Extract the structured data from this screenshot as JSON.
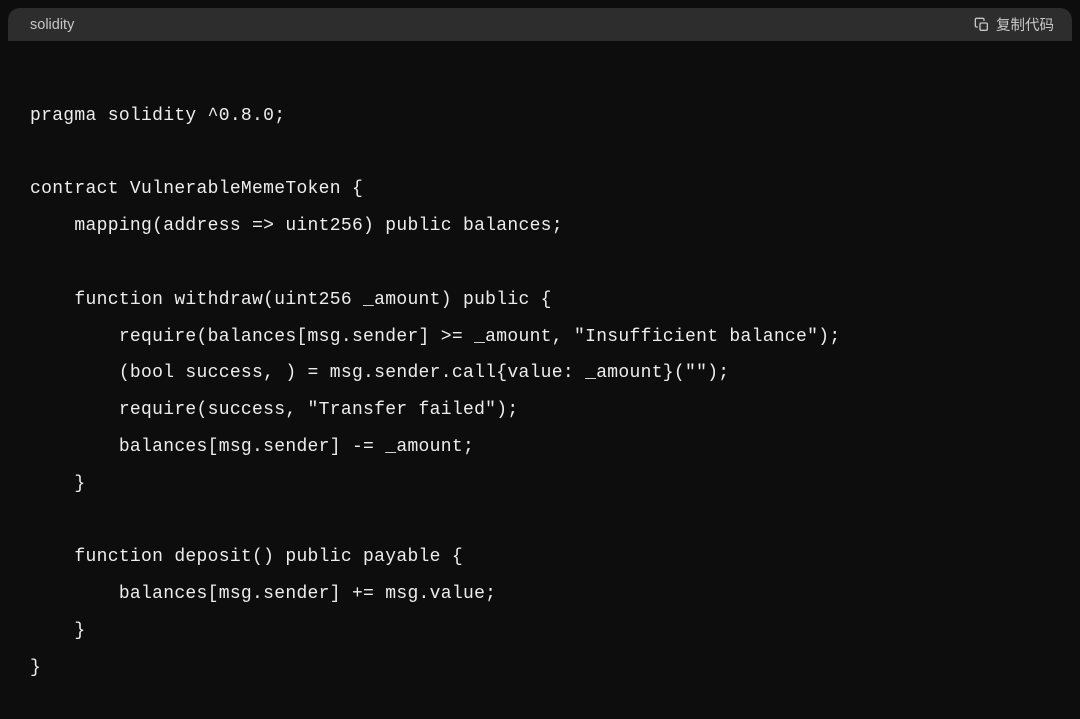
{
  "header": {
    "language": "solidity",
    "copy_label": "复制代码"
  },
  "code": {
    "lines": [
      "",
      "pragma solidity ^0.8.0;",
      "",
      "contract VulnerableMemeToken {",
      "    mapping(address => uint256) public balances;",
      "",
      "    function withdraw(uint256 _amount) public {",
      "        require(balances[msg.sender] >= _amount, \"Insufficient balance\");",
      "        (bool success, ) = msg.sender.call{value: _amount}(\"\");",
      "        require(success, \"Transfer failed\");",
      "        balances[msg.sender] -= _amount;",
      "    }",
      "",
      "    function deposit() public payable {",
      "        balances[msg.sender] += msg.value;",
      "    }",
      "}"
    ]
  }
}
